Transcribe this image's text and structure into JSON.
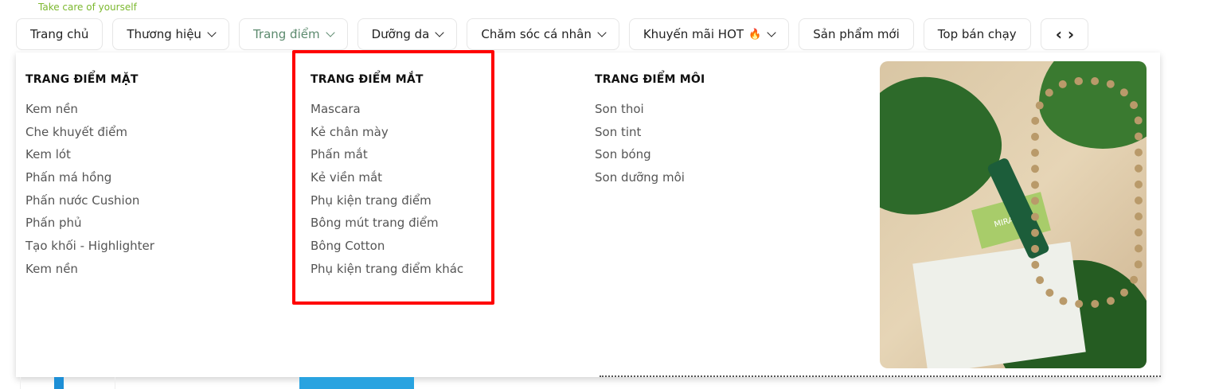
{
  "tagline": "Take care of yourself",
  "nav": [
    {
      "label": "Trang chủ",
      "dropdown": false
    },
    {
      "label": "Thương hiệu",
      "dropdown": true
    },
    {
      "label": "Trang điểm",
      "dropdown": true,
      "active": true
    },
    {
      "label": "Dưỡng da",
      "dropdown": true
    },
    {
      "label": "Chăm sóc cá nhân",
      "dropdown": true
    },
    {
      "label": "Khuyến mãi HOT",
      "dropdown": true,
      "icon": "fire-icon"
    },
    {
      "label": "Sản phẩm mới",
      "dropdown": false
    },
    {
      "label": "Top bán chạy",
      "dropdown": false
    }
  ],
  "scroll_arrows": {
    "left": "‹",
    "right": "›"
  },
  "menu": {
    "columns": [
      {
        "title": "TRANG ĐIỂM MẶT",
        "items": [
          "Kem nền",
          "Che khuyết điểm",
          "Kem lót",
          "Phấn má hồng",
          "Phấn nước Cushion",
          "Phấn phủ",
          "Tạo khối - Highlighter",
          "Kem nền"
        ]
      },
      {
        "title": "TRANG ĐIỂM MẮT",
        "items": [
          "Mascara",
          "Kẻ chân mày",
          "Phấn mắt",
          "Kẻ viền mắt",
          "Phụ kiện trang điểm",
          "Bông mút trang điểm",
          "Bông Cotton",
          "Phụ kiện trang điểm khác"
        ]
      },
      {
        "title": "TRANG ĐIỂM MÔI",
        "items": [
          "Son thoi",
          "Son tint",
          "Son bóng",
          "Son dưỡng môi"
        ]
      }
    ],
    "highlight_color": "#ff0000",
    "banner_text": "MIRACLE"
  },
  "colors": {
    "active_tab": "#5c8a6e",
    "accent_green": "#8cc63f"
  }
}
